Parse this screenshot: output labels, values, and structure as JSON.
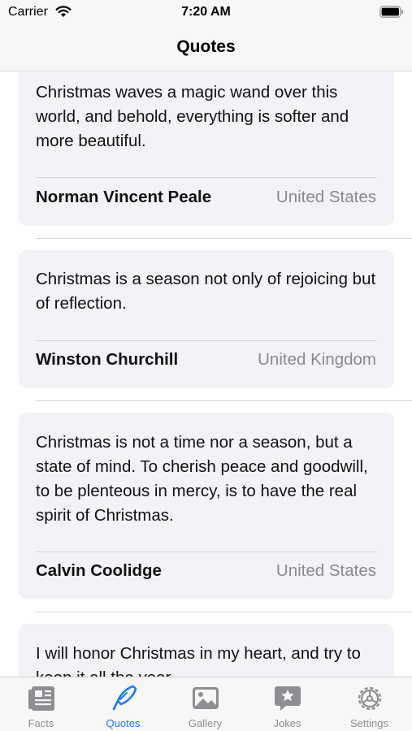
{
  "status_bar": {
    "carrier": "Carrier",
    "time": "7:20 AM"
  },
  "nav": {
    "title": "Quotes"
  },
  "quotes": [
    {
      "text": "Christmas waves a magic wand over this world, and behold, everything is softer and more beautiful.",
      "author": "Norman Vincent Peale",
      "country": "United States"
    },
    {
      "text": "Christmas is a season not only of rejoicing but of reflection.",
      "author": "Winston Churchill",
      "country": "United Kingdom"
    },
    {
      "text": "Christmas is not a time nor a season, but a state of mind. To cherish peace and goodwill, to be plenteous in mercy, is to have the real spirit of Christmas.",
      "author": "Calvin Coolidge",
      "country": "United States"
    },
    {
      "text": "I will honor Christmas in my heart, and try to keep it all the year."
    }
  ],
  "tabs": [
    {
      "label": "Facts",
      "icon": "newspaper-icon"
    },
    {
      "label": "Quotes",
      "icon": "quill-icon",
      "active": true
    },
    {
      "label": "Gallery",
      "icon": "photo-icon"
    },
    {
      "label": "Jokes",
      "icon": "star-bubble-icon"
    },
    {
      "label": "Settings",
      "icon": "gear-icon"
    }
  ],
  "colors": {
    "accent": "#1a7cf5",
    "inactive": "#8e8e93",
    "card": "#f2f2f7"
  }
}
